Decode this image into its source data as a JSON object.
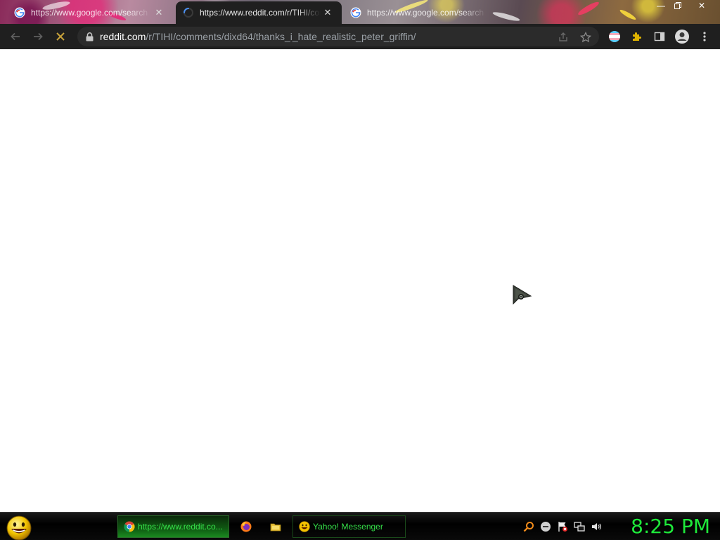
{
  "tabs": [
    {
      "title": "https://www.google.com/search",
      "state": "inactive",
      "favicon": "google-icon"
    },
    {
      "title": "https://www.reddit.com/r/TIHI/comments",
      "state": "active",
      "favicon": "loading-spinner-icon"
    },
    {
      "title": "https://www.google.com/search",
      "state": "inactive",
      "favicon": "google-icon"
    }
  ],
  "toolbar": {
    "url_host": "reddit.com",
    "url_path": "/r/TIHI/comments/dixd64/thanks_i_hate_realistic_peter_griffin/"
  },
  "taskbar": {
    "items": [
      {
        "label": "https://www.reddit.co...",
        "icon": "chrome-icon",
        "active": true
      },
      {
        "label": "",
        "icon": "firefox-icon",
        "active": false
      },
      {
        "label": "",
        "icon": "folder-icon",
        "active": false
      },
      {
        "label": "Yahoo! Messenger",
        "icon": "yahoo-messenger-icon",
        "active": false
      }
    ],
    "clock": "8:25 PM"
  },
  "colors": {
    "taskbar_text": "#36e04a",
    "clock": "#1ee83a",
    "toolbar_bg": "#1f1f1f",
    "omnibox_bg": "#2b2b2b"
  }
}
